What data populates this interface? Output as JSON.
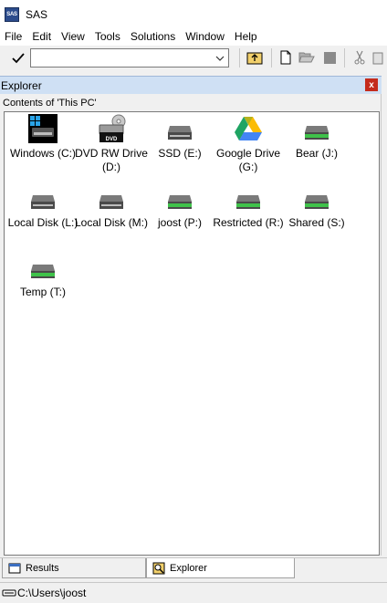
{
  "window": {
    "title": "SAS",
    "app_icon_text": "SAS"
  },
  "menu": [
    "File",
    "Edit",
    "View",
    "Tools",
    "Solutions",
    "Window",
    "Help"
  ],
  "toolbar": {
    "command_value": ""
  },
  "explorer": {
    "title": "Explorer",
    "contents_label": "Contents of 'This PC'",
    "drives": [
      {
        "label": "Windows (C:)",
        "icon": "windows-drive-icon"
      },
      {
        "label": "DVD RW Drive (D:)",
        "icon": "dvd-drive-icon"
      },
      {
        "label": "SSD (E:)",
        "icon": "hard-drive-icon"
      },
      {
        "label": "Google Drive (G:)",
        "icon": "google-drive-icon"
      },
      {
        "label": "Bear (J:)",
        "icon": "network-drive-icon"
      },
      {
        "label": "Local Disk (L:)",
        "icon": "hard-drive-icon"
      },
      {
        "label": "Local Disk (M:)",
        "icon": "hard-drive-icon"
      },
      {
        "label": "joost (P:)",
        "icon": "network-drive-icon"
      },
      {
        "label": "Restricted (R:)",
        "icon": "network-drive-icon"
      },
      {
        "label": "Shared (S:)",
        "icon": "network-drive-icon"
      },
      {
        "label": "Temp (T:)",
        "icon": "network-drive-icon"
      }
    ]
  },
  "tabs": [
    {
      "label": "Results",
      "icon": "results-icon"
    },
    {
      "label": "Explorer",
      "icon": "explorer-icon"
    }
  ],
  "status": {
    "path": "C:\\Users\\joost"
  },
  "colors": {
    "panel_header": "#cfe0f4",
    "close_button": "#c42b1c",
    "drive_green": "#3fc24a"
  }
}
